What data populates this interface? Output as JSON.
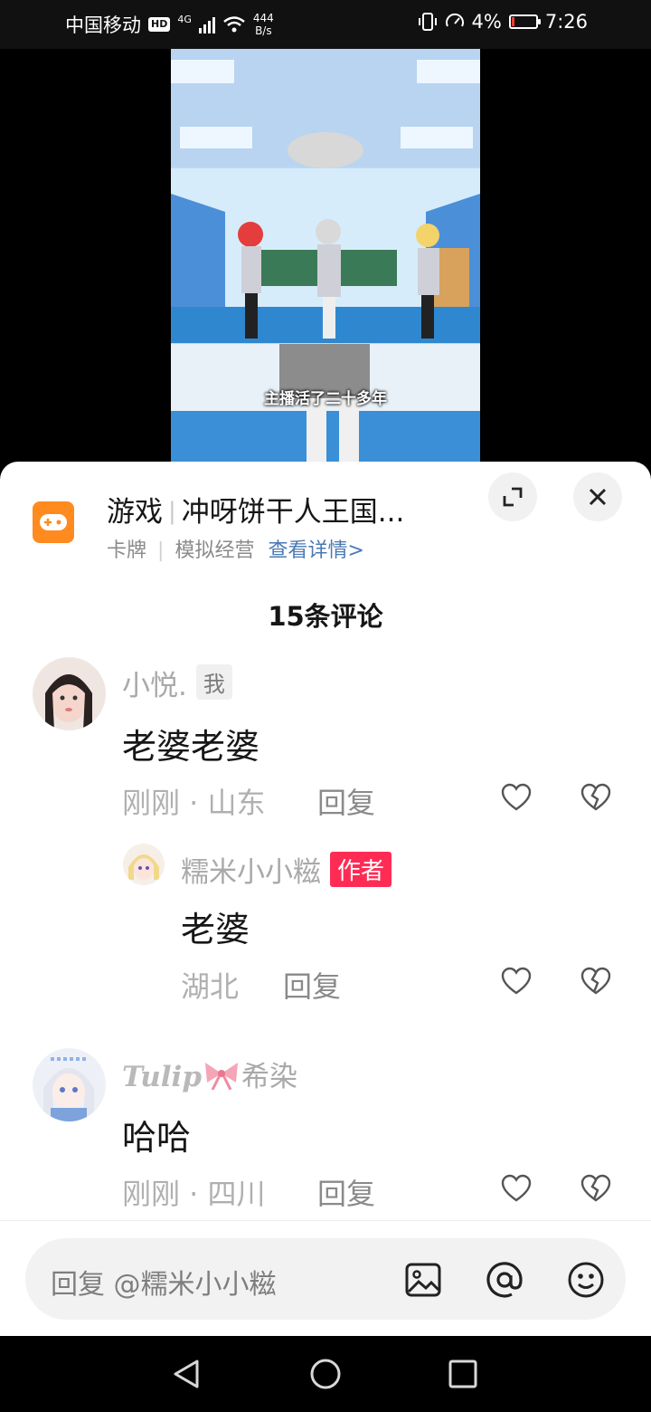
{
  "status_bar": {
    "carrier": "中国移动",
    "hd_badge": "HD",
    "network": "4G",
    "net_speed_value": "444",
    "net_speed_unit": "B/s",
    "battery_percent": "4%",
    "time": "7:26"
  },
  "video": {
    "subtitle": "主播活了二十多年"
  },
  "game_panel": {
    "category": "游戏",
    "title": "冲呀饼干人王国...",
    "tag1": "卡牌",
    "tag2": "模拟经营",
    "details_link": "查看详情>"
  },
  "comments_header": {
    "count_label": "15条评论"
  },
  "comments": [
    {
      "username": "小悦.",
      "badge": "我",
      "text": "老婆老婆",
      "meta": "刚刚 · 山东",
      "reply_label": "回复",
      "replies": [
        {
          "username": "糯米小小糍",
          "badge": "作者",
          "text": "老婆",
          "meta": "湖北",
          "reply_label": "回复"
        }
      ]
    },
    {
      "username_prefix": "Tulip",
      "username_suffix": "希染",
      "text": "哈哈",
      "meta": "刚刚 · 四川",
      "reply_label": "回复"
    }
  ],
  "input_bar": {
    "placeholder": "回复 @糯米小小糍"
  },
  "icons": {
    "game": "gamepad-icon",
    "expand": "expand-icon",
    "close": "close-icon",
    "like": "heart-icon",
    "dislike": "broken-heart-icon",
    "image": "image-icon",
    "mention": "at-icon",
    "emoji": "emoji-icon",
    "back": "back-triangle-icon",
    "home": "home-circle-icon",
    "recents": "recents-square-icon"
  },
  "colors": {
    "author_badge": "#fe2c55",
    "game_icon": "#ff8a1f",
    "link": "#4a7ab5",
    "battery_low": "#ff3b30"
  }
}
